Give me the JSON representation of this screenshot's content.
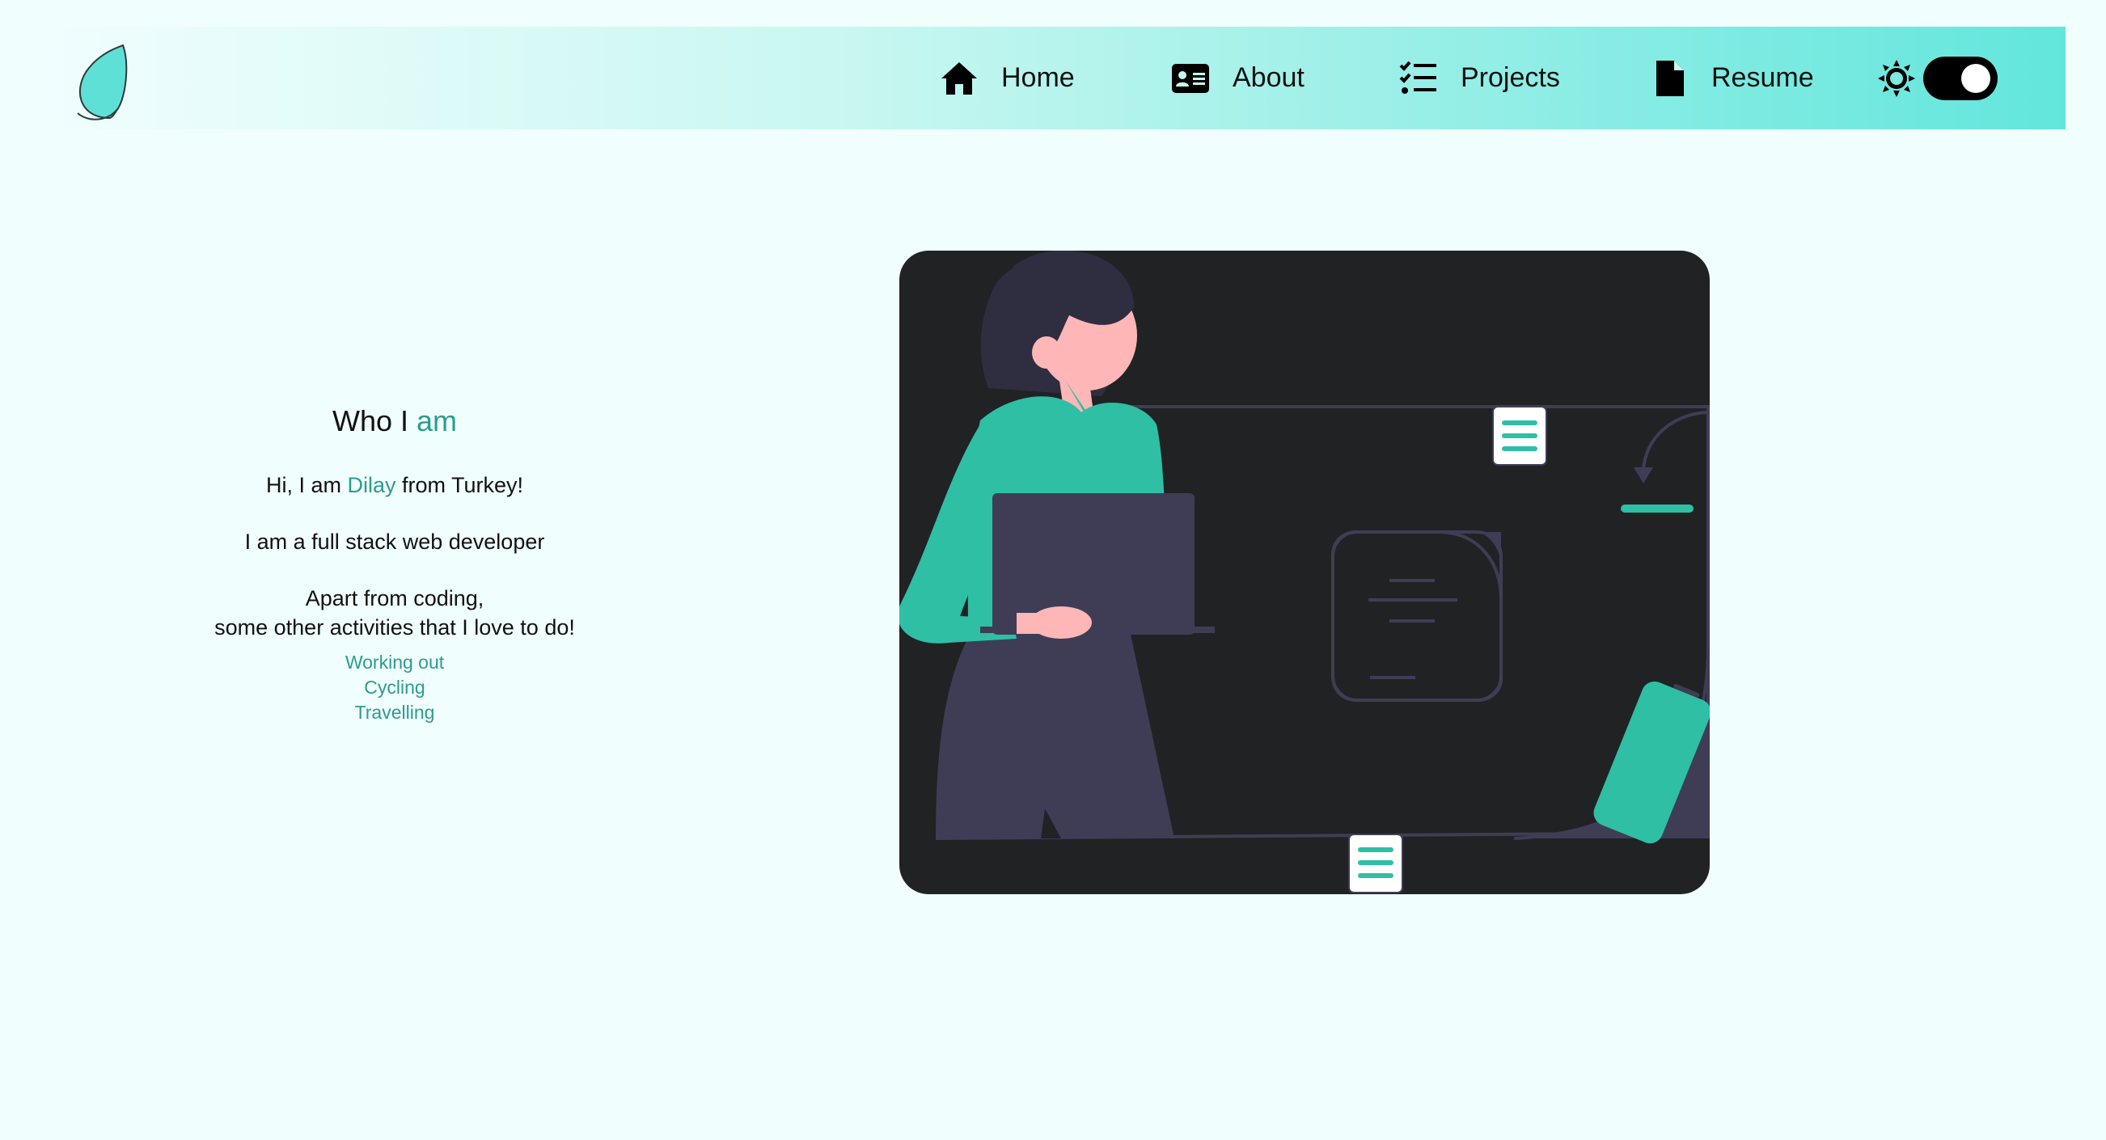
{
  "navbar": {
    "items": [
      {
        "label": "Home",
        "icon": "home-icon"
      },
      {
        "label": "About",
        "icon": "id-card-icon"
      },
      {
        "label": "Projects",
        "icon": "checklist-icon"
      },
      {
        "label": "Resume",
        "icon": "file-icon"
      }
    ],
    "theme_icon": "sun-icon",
    "colors": {
      "accent": "#2b9c8f",
      "gradient_end": "#62e6dc",
      "background": "#f1fefe"
    }
  },
  "about": {
    "title_main": "Who I",
    "title_accent": "am",
    "intro_prefix": "Hi, I am",
    "intro_name": "Dilay",
    "intro_suffix": "from Turkey!",
    "role": "I am a full stack web developer",
    "hobbies_line1": "Apart from coding,",
    "hobbies_line2": "some other activities that I love to do!",
    "activities": [
      "Working out",
      "Cycling",
      "Travelling"
    ]
  },
  "illustration": {
    "subject": "woman-with-laptop-illustration",
    "colors": {
      "panel": "#212223",
      "teal": "#2ebfa5",
      "dark": "#3f3d56",
      "skin": "#ffb6b6"
    }
  }
}
